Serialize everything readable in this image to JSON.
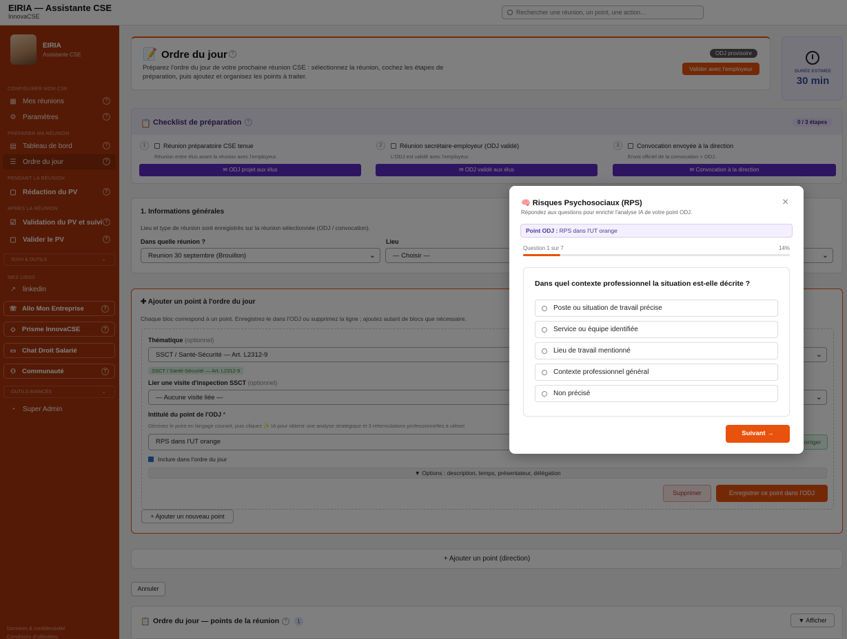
{
  "app": {
    "title": "EIRIA — Assistante CSE",
    "subtitle": "InnovaCSE"
  },
  "search": {
    "placeholder": "Rechercher une réunion, un point, une action..."
  },
  "sidebar": {
    "name": "EIRIA",
    "role": "Assistante CSE",
    "sections": {
      "configure": "CONFIGURER MON CSE",
      "prepare": "PRÉPARER MA RÉUNION",
      "during": "PENDANT LA RÉUNION",
      "after": "APRÈS LA RÉUNION",
      "links": "MES LIENS"
    },
    "items": [
      {
        "label": "Mes réunions",
        "icon": "calendar-icon"
      },
      {
        "label": "Paramètres",
        "icon": "gear-icon"
      },
      {
        "label": "Tableau de bord",
        "icon": "grid-icon"
      },
      {
        "label": "Ordre du jour",
        "icon": "list-icon"
      },
      {
        "label": "Rédaction du PV",
        "icon": "document-icon"
      },
      {
        "label": "Validation du PV et suivi",
        "icon": "check-icon"
      },
      {
        "label": "Valider le PV",
        "icon": "document-icon"
      }
    ],
    "suivi": "SUIVI & OUTILS",
    "linkedin": "linkedin",
    "boxes": [
      {
        "label": "Allo Mon Entreprise",
        "icon": "phone-icon"
      },
      {
        "label": "Prisme InnovaCSE",
        "icon": "diamond-icon"
      },
      {
        "label": "Chat Droit Salarié",
        "icon": "chat-icon"
      },
      {
        "label": "Communauté",
        "icon": "users-icon"
      }
    ],
    "advanced": "OUTILS AVANCÉS",
    "super_admin": "Super Admin",
    "footer1": "Données & confidentialité",
    "footer2": "Conditions d'utilisation"
  },
  "header_card": {
    "title": "Ordre du jour",
    "description": "Préparez l'ordre du jour de votre prochaine réunion CSE : sélectionnez la réunion, cochez les étapes de préparation, puis ajoutez et organisez les points à traiter.",
    "badge": "ODJ provisoire",
    "validate": "Valider avec l'employeur"
  },
  "duration": {
    "label": "DURÉE ESTIMÉE",
    "value": "30 min"
  },
  "checklist": {
    "title": "Checklist de préparation",
    "progress": "0 / 3 étapes",
    "steps": [
      {
        "num": "1",
        "label": "Réunion préparatoire CSE tenue",
        "hint": "Réunion entre élus avant la réunion avec l'employeur.",
        "button": "ODJ projet aux élus"
      },
      {
        "num": "2",
        "label": "Réunion secrétaire-employeur (ODJ validé)",
        "hint": "L'ODJ est validé avec l'employeur.",
        "button": "ODJ validé aux élus"
      },
      {
        "num": "3",
        "label": "Convocation envoyée à la direction",
        "hint": "Envoi officiel de la convocation + ODJ.",
        "button": "Convocation à la direction"
      }
    ]
  },
  "info": {
    "title": "1. Informations générales",
    "note": "Lieu et type de réunion sont enregistrés sur la réunion sélectionnée (ODJ / convocation).",
    "meeting_label": "Dans quelle réunion ?",
    "meeting_value": "Reunion 30 septembre (Brouillon)",
    "place_label": "Lieu",
    "place_value": "— Choisir —"
  },
  "add_point": {
    "title": "Ajouter un point à l'ordre du jour",
    "note": "Chaque bloc correspond à un point. Enregistrez-le dans l'ODJ ou supprimez la ligne ; ajoutez autant de blocs que nécessaire.",
    "theme_label": "Thématique",
    "theme_optional": "(optionnel)",
    "theme_value": "SSCT / Santé-Sécurité — Art. L2312-9",
    "theme_tag": "SSCT / Santé-Sécurité — Art. L2312-9",
    "visit_label": "Lier une visite d'inspection SSCT",
    "visit_optional": "(optionnel)",
    "visit_value": "— Aucune visite liée —",
    "title_label": "Intitulé du point de l'ODJ",
    "required": "*",
    "title_hint": "Décrivez le point en langage courant, puis cliquez ✨ IA pour obtenir une analyse stratégique et 3 reformulations professionnelles à utiliser",
    "title_value": "RPS dans l'UT orange",
    "correct": "Corriger",
    "include": "Inclure dans l'ordre du jour",
    "options": "▼ Options : description, temps, présentateur, délégation",
    "delete": "Supprimer",
    "save": "Enregistrer ce point dans l'ODJ",
    "add_new": "+ Ajouter un nouveau point"
  },
  "direction": {
    "label": "+ Ajouter un point (direction)"
  },
  "cancel": "Annuler",
  "odj_list": {
    "title": "Ordre du jour — points de la réunion",
    "count": "1",
    "toggle": "▼ Afficher"
  },
  "modal": {
    "title": "🧠 Risques Psychosociaux (RPS)",
    "subtitle": "Répondez aux questions pour enrichir l'analyse IA de votre point ODJ.",
    "point_label": "Point ODJ :",
    "point_value": "RPS dans l'UT orange",
    "question_counter": "Question 1 sur 7",
    "percent": "14%",
    "progress": 0.14,
    "question": "Dans quel contexte professionnel la situation est-elle décrite ?",
    "options": [
      "Poste ou situation de travail précise",
      "Service ou équipe identifiée",
      "Lieu de travail mentionné",
      "Contexte professionnel général",
      "Non précisé"
    ],
    "next": "Suivant →"
  },
  "colors": {
    "brand": "#a8350d",
    "accent": "#e8520c",
    "purple": "#5b2bc5"
  }
}
